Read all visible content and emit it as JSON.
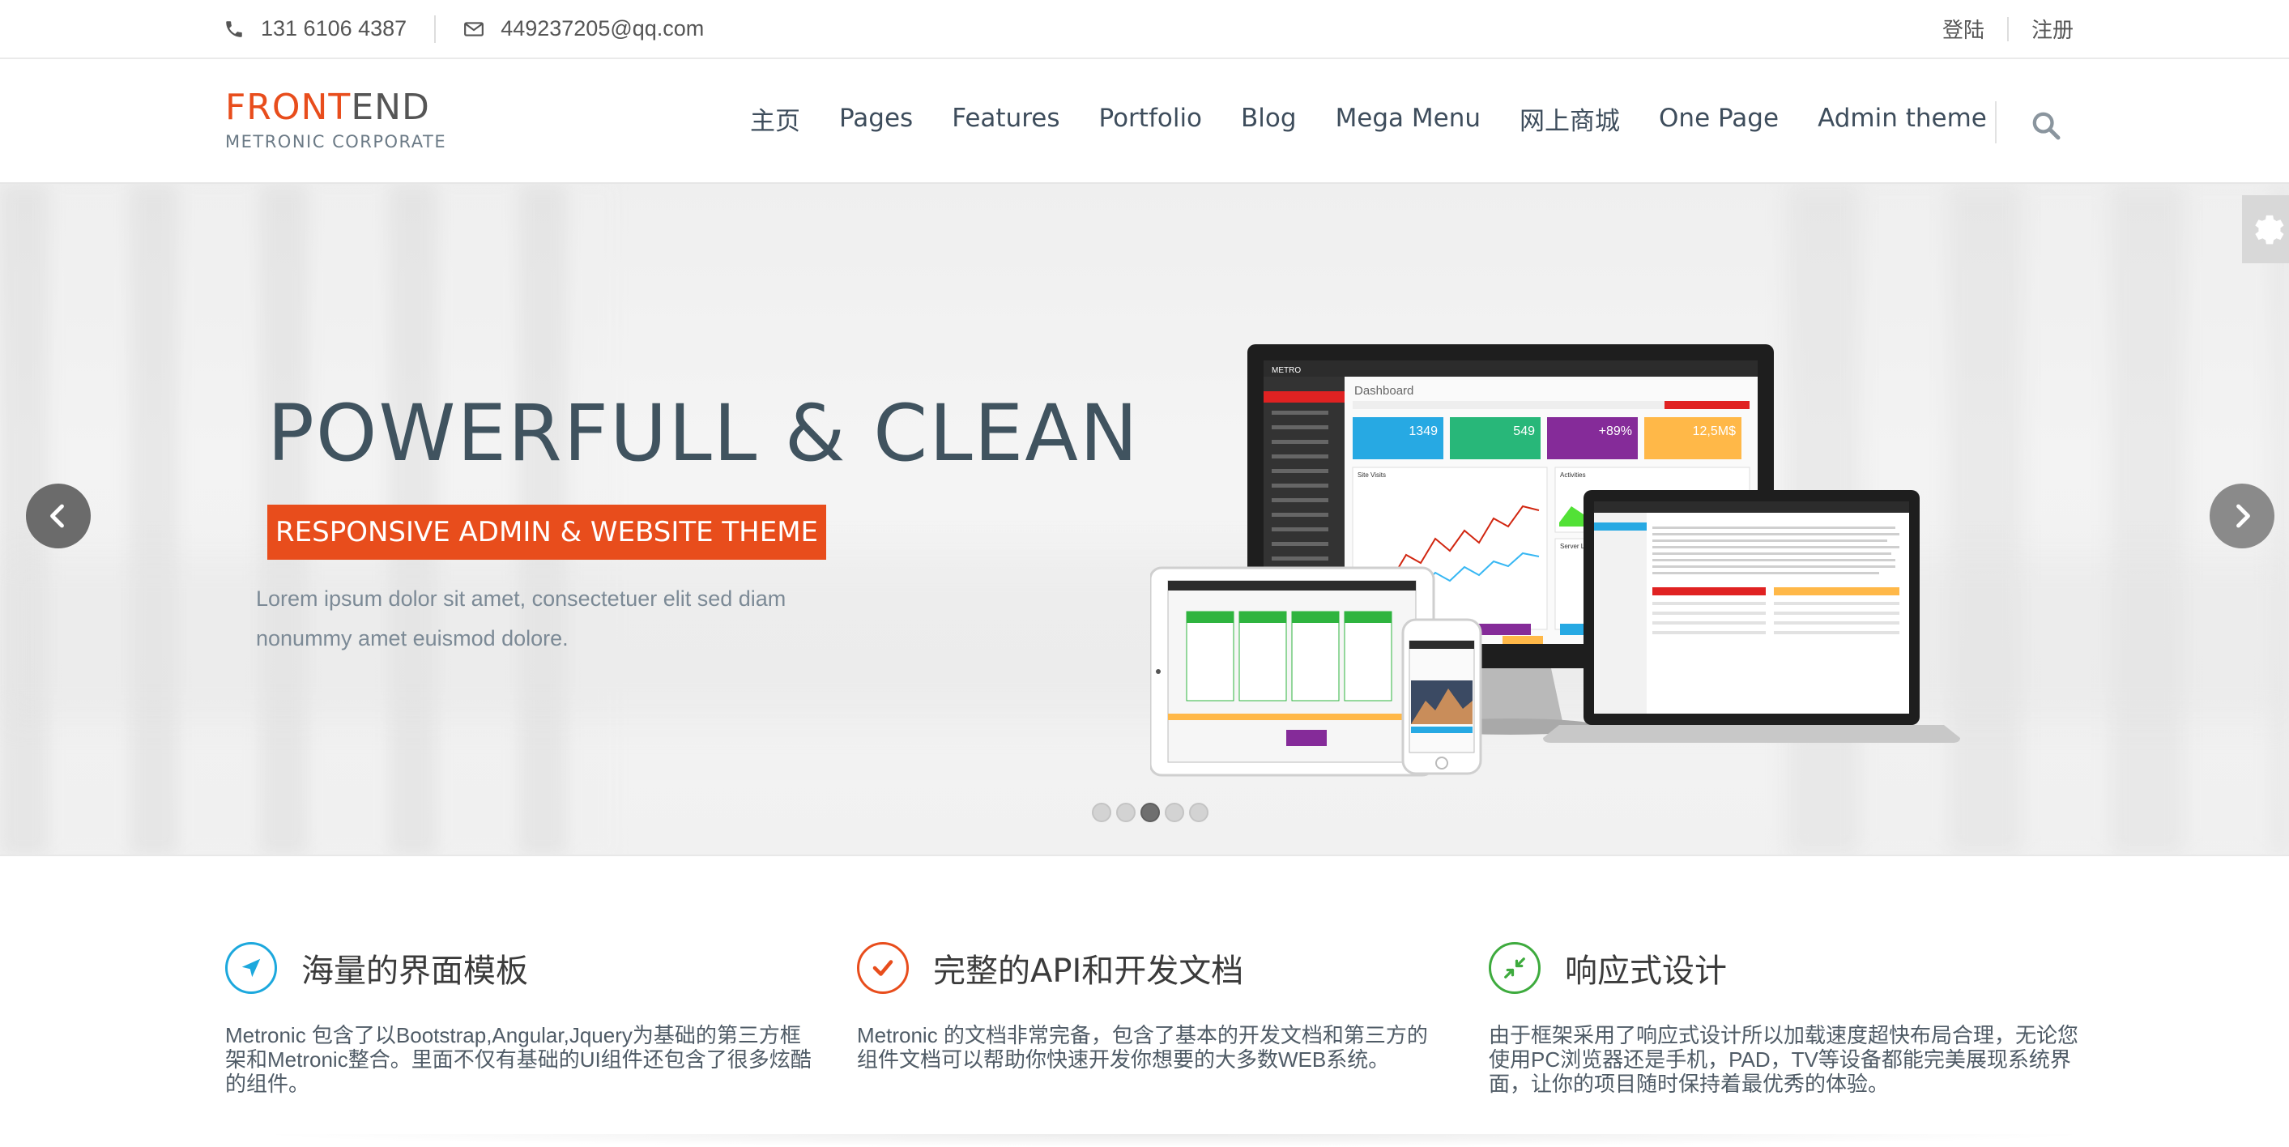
{
  "topbar": {
    "phone": "131 6106 4387",
    "email": "449237205@qq.com",
    "login": "登陆",
    "register": "注册"
  },
  "logo": {
    "part1": "FRONT",
    "part2": "END",
    "subtitle": "METRONIC CORPORATE"
  },
  "nav": {
    "items": [
      "主页",
      "Pages",
      "Features",
      "Portfolio",
      "Blog",
      "Mega Menu",
      "网上商城",
      "One Page",
      "Admin theme"
    ]
  },
  "hero": {
    "title": "POWERFULL & CLEAN",
    "badge": "RESPONSIVE ADMIN & WEBSITE THEME",
    "text": "Lorem ipsum dolor sit amet, consectetuer elit sed diam nonummy amet euismod dolore.",
    "slides": 5,
    "active_slide": 3,
    "mockup": {
      "dashboard_title": "Dashboard",
      "stats": [
        "1349",
        "549",
        "+89%",
        "12,5M$"
      ],
      "panels": [
        "Site Visits",
        "Activities",
        "Server Load"
      ],
      "brand": "METRO"
    }
  },
  "features": [
    {
      "icon": "location-arrow-icon",
      "color": "#1ca8dd",
      "title": "海量的界面模板",
      "text": "Metronic 包含了以Bootstrap,Angular,Jquery为基础的第三方框架和Metronic整合。里面不仅有基础的UI组件还包含了很多炫酷的组件。"
    },
    {
      "icon": "check-icon",
      "color": "#e84d1c",
      "title": "完整的API和开发文档",
      "text": "Metronic 的文档非常完备，包含了基本的开发文档和第三方的组件文档可以帮助你快速开发你想要的大多数WEB系统。"
    },
    {
      "icon": "compress-icon",
      "color": "#3eab3e",
      "title": "响应式设计",
      "text": "由于框架采用了响应式设计所以加载速度超快布局合理，无论您使用PC浏览器还是手机，PAD，TV等设备都能完美展现系统界面，让你的项目随时保持着最优秀的体验。"
    }
  ],
  "colors": {
    "accent": "#e84d1c",
    "heading": "#40535f",
    "nav_text": "#3e4d5c"
  }
}
